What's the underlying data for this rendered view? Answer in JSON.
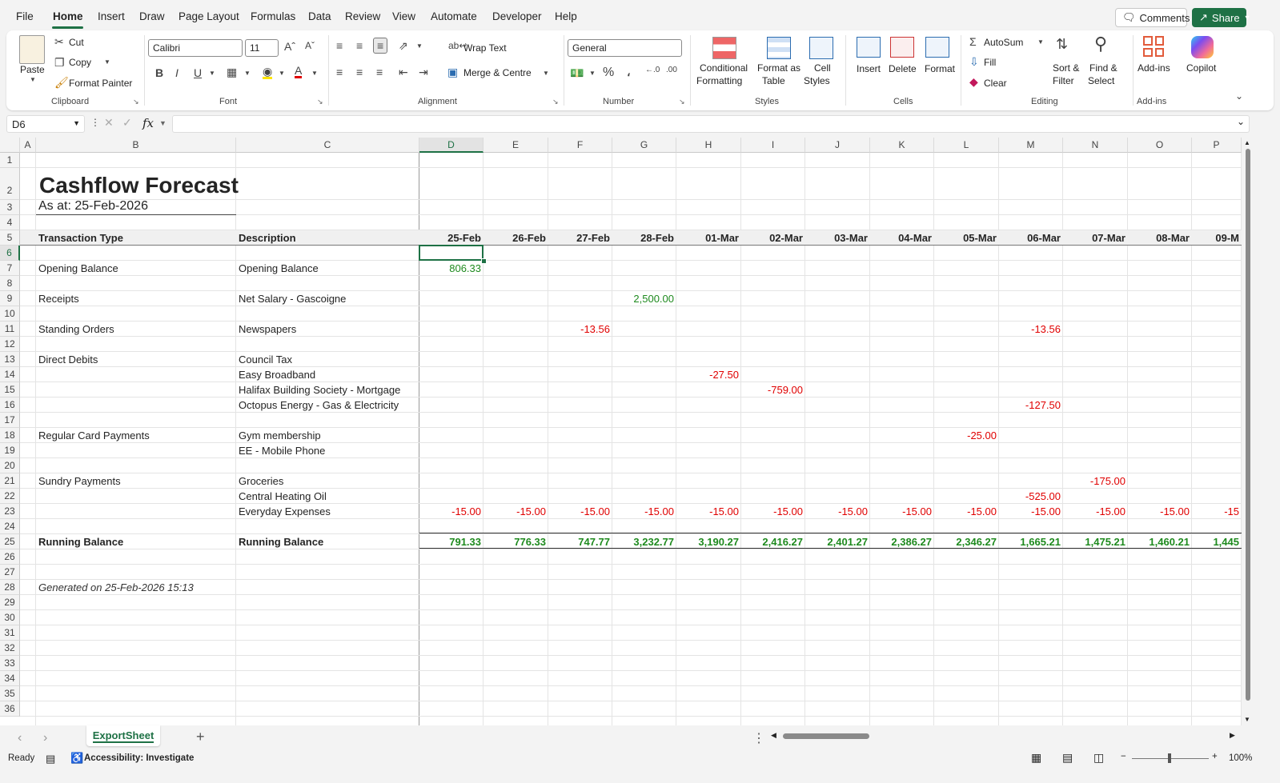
{
  "menu": [
    "File",
    "Home",
    "Insert",
    "Draw",
    "Page Layout",
    "Formulas",
    "Data",
    "Review",
    "View",
    "Automate",
    "Developer",
    "Help"
  ],
  "header_buttons": {
    "comments": "Comments",
    "share": "Share"
  },
  "ribbon": {
    "clipboard": {
      "paste": "Paste",
      "cut": "Cut",
      "copy": "Copy",
      "format_painter": "Format Painter",
      "label": "Clipboard"
    },
    "font": {
      "name": "Calibri",
      "size": "11",
      "bold": "B",
      "italic": "I",
      "underline": "U",
      "label": "Font"
    },
    "alignment": {
      "wrap": "Wrap Text",
      "merge": "Merge & Centre",
      "label": "Alignment"
    },
    "number": {
      "format": "General",
      "label": "Number"
    },
    "styles": {
      "conditional": "Conditional",
      "conditional2": "Formatting",
      "format_table": "Format as",
      "format_table2": "Table",
      "cell_styles": "Cell",
      "cell_styles2": "Styles",
      "label": "Styles"
    },
    "cells": {
      "insert": "Insert",
      "delete": "Delete",
      "format": "Format",
      "label": "Cells"
    },
    "editing": {
      "autosum": "AutoSum",
      "fill": "Fill",
      "clear": "Clear",
      "sort": "Sort &",
      "sort2": "Filter",
      "find": "Find &",
      "find2": "Select",
      "label": "Editing"
    },
    "addins": {
      "addins": "Add-ins",
      "copilot": "Copilot",
      "label": "Add-ins"
    }
  },
  "formula_bar": {
    "name_box": "D6",
    "fx": "fx",
    "value": ""
  },
  "columns": [
    "A",
    "B",
    "C",
    "D",
    "E",
    "F",
    "G",
    "H",
    "I",
    "J",
    "K",
    "L",
    "M",
    "N",
    "O",
    "P"
  ],
  "rows": [
    "1",
    "2",
    "3",
    "4",
    "5",
    "6",
    "7",
    "8",
    "9",
    "10",
    "11",
    "12",
    "13",
    "14",
    "15",
    "16",
    "17",
    "18",
    "19",
    "20",
    "21",
    "22",
    "23",
    "24",
    "25",
    "26",
    "27",
    "28",
    "29",
    "30",
    "31",
    "32",
    "33",
    "34",
    "35",
    "36"
  ],
  "sheet": {
    "title": "Cashflow Forecast",
    "as_at": "As at: 25-Feb-2026",
    "header_type": "Transaction Type",
    "header_desc": "Description",
    "dates": [
      "25-Feb",
      "26-Feb",
      "27-Feb",
      "28-Feb",
      "01-Mar",
      "02-Mar",
      "03-Mar",
      "04-Mar",
      "05-Mar",
      "06-Mar",
      "07-Mar",
      "08-Mar",
      "09-M"
    ],
    "rows": [
      {
        "row": 7,
        "type": "Opening Balance",
        "desc": "Opening Balance",
        "values": {
          "D": "806.33"
        }
      },
      {
        "row": 9,
        "type": "Receipts",
        "desc": "Net Salary - Gascoigne",
        "values": {
          "G": "2,500.00"
        }
      },
      {
        "row": 11,
        "type": "Standing Orders",
        "desc": "Newspapers",
        "values": {
          "F": "-13.56",
          "M": "-13.56"
        }
      },
      {
        "row": 13,
        "type": "Direct Debits",
        "desc": "Council Tax",
        "values": {}
      },
      {
        "row": 14,
        "type": "",
        "desc": "Easy Broadband",
        "values": {
          "H": "-27.50"
        }
      },
      {
        "row": 15,
        "type": "",
        "desc": "Halifax Building Society - Mortgage",
        "values": {
          "I": "-759.00"
        }
      },
      {
        "row": 16,
        "type": "",
        "desc": "Octopus Energy - Gas & Electricity",
        "values": {
          "M": "-127.50"
        }
      },
      {
        "row": 18,
        "type": "Regular Card Payments",
        "desc": "Gym membership",
        "values": {
          "L": "-25.00"
        }
      },
      {
        "row": 19,
        "type": "",
        "desc": "EE - Mobile Phone",
        "values": {}
      },
      {
        "row": 21,
        "type": "Sundry Payments",
        "desc": "Groceries",
        "values": {
          "N": "-175.00"
        }
      },
      {
        "row": 22,
        "type": "",
        "desc": "Central Heating Oil",
        "values": {
          "M": "-525.00"
        }
      },
      {
        "row": 23,
        "type": "",
        "desc": "Everyday Expenses",
        "values": {
          "D": "-15.00",
          "E": "-15.00",
          "F": "-15.00",
          "G": "-15.00",
          "H": "-15.00",
          "I": "-15.00",
          "J": "-15.00",
          "K": "-15.00",
          "L": "-15.00",
          "M": "-15.00",
          "N": "-15.00",
          "O": "-15.00",
          "P": "-15"
        }
      }
    ],
    "running_label": "Running Balance",
    "running_desc": "Running Balance",
    "running": [
      "791.33",
      "776.33",
      "747.77",
      "3,232.77",
      "3,190.27",
      "2,416.27",
      "2,401.27",
      "2,386.27",
      "2,346.27",
      "1,665.21",
      "1,475.21",
      "1,460.21",
      "1,445"
    ],
    "generated": "Generated on 25-Feb-2026 15:13"
  },
  "tabs": {
    "active": "ExportSheet",
    "add": "+"
  },
  "status": {
    "ready": "Ready",
    "accessibility": "Accessibility: Investigate",
    "zoom": "100%"
  }
}
